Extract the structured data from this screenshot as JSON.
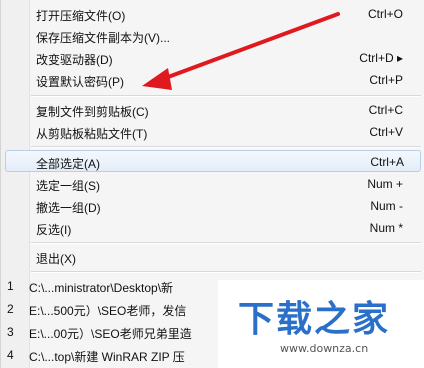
{
  "menu": {
    "group1": [
      {
        "label": "打开压缩文件(O)",
        "shortcut": "Ctrl+O"
      },
      {
        "label": "保存压缩文件副本为(V)...",
        "shortcut": ""
      },
      {
        "label": "改变驱动器(D)",
        "shortcut": "Ctrl+D ▸"
      },
      {
        "label": "设置默认密码(P)",
        "shortcut": "Ctrl+P"
      }
    ],
    "group2": [
      {
        "label": "复制文件到剪贴板(C)",
        "shortcut": "Ctrl+C"
      },
      {
        "label": "从剪贴板粘贴文件(T)",
        "shortcut": "Ctrl+V"
      }
    ],
    "group3": [
      {
        "label": "全部选定(A)",
        "shortcut": "Ctrl+A"
      },
      {
        "label": "选定一组(S)",
        "shortcut": "Num +"
      },
      {
        "label": "撤选一组(D)",
        "shortcut": "Num -"
      },
      {
        "label": "反选(I)",
        "shortcut": "Num *"
      }
    ],
    "exit": {
      "label": "退出(X)"
    },
    "recent": [
      {
        "num": "1",
        "path": "C:\\...ministrator\\Desktop\\新"
      },
      {
        "num": "2",
        "path": "E:\\...500元）\\SEO老师，发信"
      },
      {
        "num": "3",
        "path": "E:\\...00元）\\SEO老师兄弟里造"
      },
      {
        "num": "4",
        "path": "C:\\...top\\新建 WinRAR ZIP 压"
      }
    ]
  },
  "watermark": {
    "title": "下载之家",
    "url": "www.downza.cn"
  },
  "colors": {
    "arrow": "#e0191f",
    "selection": "#e3edf8",
    "logo": "#2a6fc9"
  }
}
